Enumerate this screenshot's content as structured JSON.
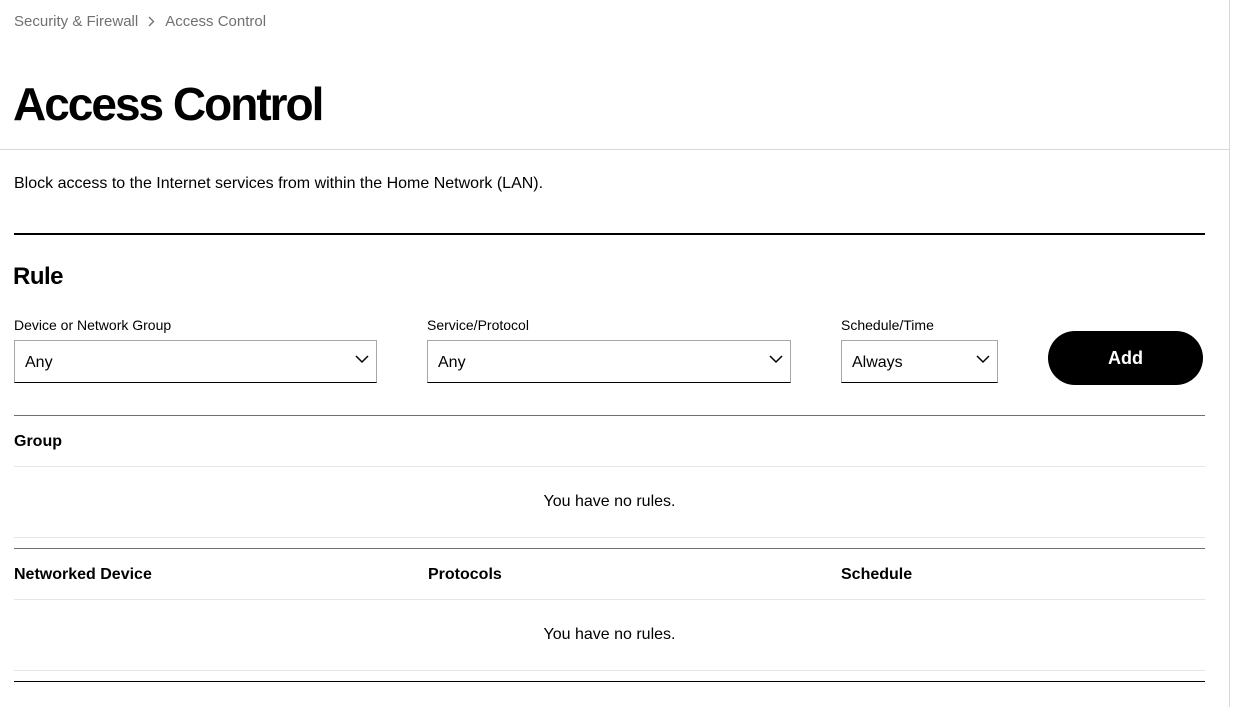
{
  "breadcrumb": {
    "items": [
      "Security & Firewall",
      "Access Control"
    ]
  },
  "page": {
    "title": "Access Control",
    "description": "Block access to the Internet services from within the Home Network (LAN)."
  },
  "rule": {
    "title": "Rule",
    "device_label": "Device or Network Group",
    "device_value": "Any",
    "service_label": "Service/Protocol",
    "service_value": "Any",
    "schedule_label": "Schedule/Time",
    "schedule_value": "Always",
    "add_label": "Add"
  },
  "group_table": {
    "header": "Group",
    "empty_message": "You have no rules."
  },
  "device_table": {
    "columns": [
      "Networked Device",
      "Protocols",
      "Schedule"
    ],
    "empty_message": "You have no rules."
  },
  "icons": {
    "breadcrumb_separator": "chevron-right-icon",
    "select_arrow": "chevron-down-icon"
  },
  "colors": {
    "text": "#000000",
    "muted_text": "#6f7171",
    "button_bg": "#000000",
    "button_text": "#ffffff"
  }
}
